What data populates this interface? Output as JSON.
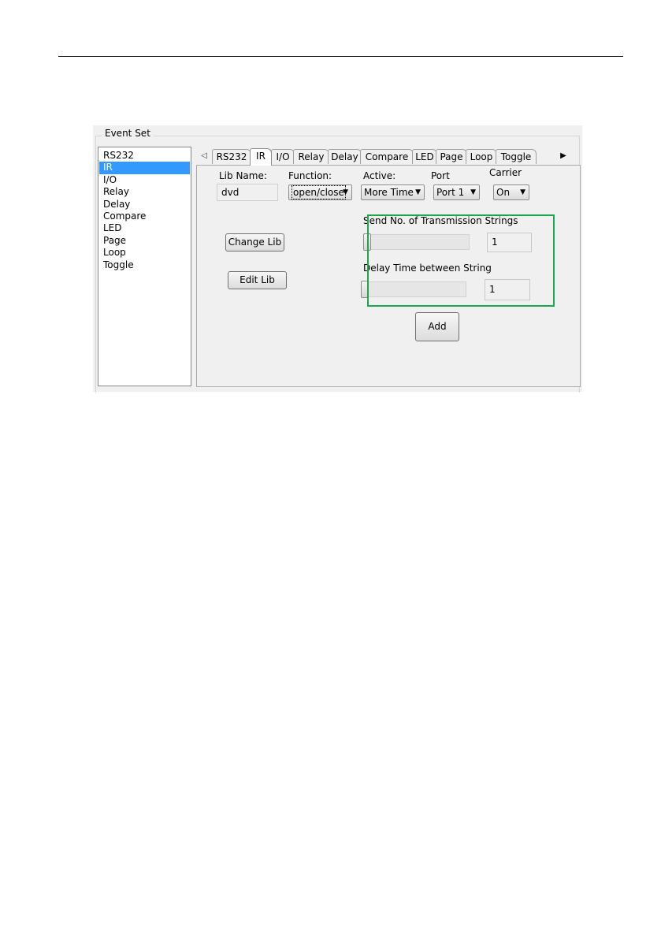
{
  "group_title": "Event Set",
  "event_list": {
    "items": [
      "RS232",
      "IR",
      "I/O",
      "Relay",
      "Delay",
      "Compare",
      "LED",
      "Page",
      "Loop",
      "Toggle"
    ],
    "selected": "IR"
  },
  "tabs": {
    "items": [
      "RS232",
      "IR",
      "I/O",
      "Relay",
      "Delay",
      "Compare",
      "LED",
      "Page",
      "Loop",
      "Toggle"
    ],
    "active": "IR",
    "scroll_left": "◁",
    "scroll_right": "▶"
  },
  "ir_panel": {
    "lib_name_label": "Lib Name:",
    "lib_name_value": "dvd",
    "function_label": "Function:",
    "function_value": "open/close",
    "active_label": "Active:",
    "active_value": "More Time",
    "port_label": "Port",
    "port_value": "Port 1",
    "carrier_label": "Carrier",
    "carrier_value": "On",
    "change_lib_button": "Change Lib",
    "edit_lib_button": "Edit Lib",
    "send_strings_label": "Send No. of Transmission Strings",
    "send_strings_value": "1",
    "send_strings_slider_level": 0,
    "delay_label": "Delay Time between String",
    "delay_value": "1",
    "delay_slider_level": 0,
    "add_button": "Add",
    "dropdown_arrow": "▼"
  },
  "colors": {
    "selection": "#3399ff",
    "highlight_box": "#19a84c"
  }
}
